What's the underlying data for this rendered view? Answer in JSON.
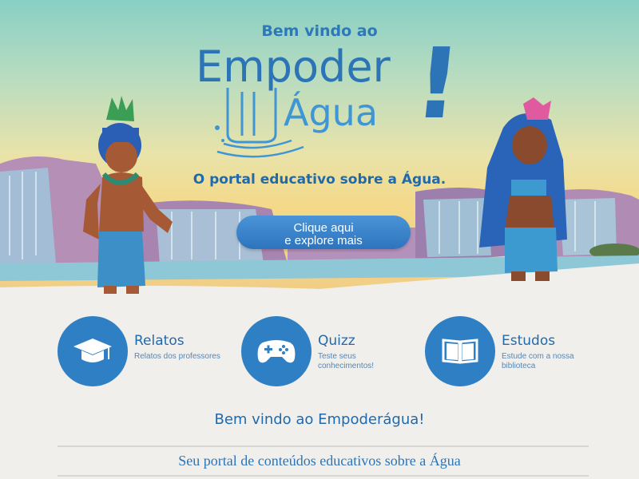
{
  "hero": {
    "welcome": "Bem vindo ao",
    "logo_line1": "Empoder",
    "logo_line2": "Água",
    "logo_bang": "!",
    "tagline": "O portal educativo sobre a Água.",
    "cta_line1": "Clique aqui",
    "cta_line2": "e explore mais"
  },
  "features": [
    {
      "title": "Relatos",
      "desc": "Relatos dos professores",
      "icon": "graduation-cap-icon"
    },
    {
      "title": "Quizz",
      "desc": "Teste seus conhecimentos!",
      "icon": "gamepad-icon"
    },
    {
      "title": "Estudos",
      "desc": "Estude com a nossa biblioteca",
      "icon": "open-book-icon"
    }
  ],
  "main": {
    "welcome_title": "Bem vindo ao Empoderágua!",
    "subtitle": "Seu portal de conteúdos educativos sobre a Água"
  },
  "colors": {
    "brand_blue": "#2d74b6",
    "accent_blue": "#3f96d4",
    "circle_blue": "#2f7fc5",
    "background": "#f1efeb"
  }
}
